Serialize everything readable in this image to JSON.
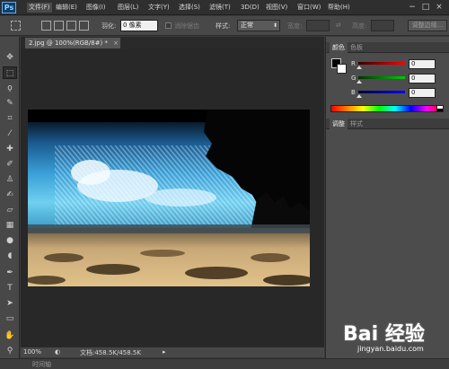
{
  "app": {
    "logo": "Ps"
  },
  "menu": [
    "文件(F)",
    "编辑(E)",
    "图像(I)",
    "图层(L)",
    "文字(Y)",
    "选择(S)",
    "滤镜(T)",
    "3D(D)",
    "视图(V)",
    "窗口(W)",
    "帮助(H)"
  ],
  "window_controls": [
    "−",
    "□",
    "×"
  ],
  "options_bar": {
    "feather_label": "羽化:",
    "feather_value": "0 像素",
    "antialias_label": "消除锯齿",
    "style_label": "样式:",
    "style_value": "正常",
    "width_label": "宽度:",
    "height_label": "高度:",
    "refine_edge": "调整边缘..."
  },
  "tools": [
    {
      "name": "move-tool",
      "glyph": "✥"
    },
    {
      "name": "marquee-tool",
      "glyph": "⬚"
    },
    {
      "name": "lasso-tool",
      "glyph": "ϙ"
    },
    {
      "name": "quick-select-tool",
      "glyph": "✎"
    },
    {
      "name": "crop-tool",
      "glyph": "⌗"
    },
    {
      "name": "eyedropper-tool",
      "glyph": "⁄"
    },
    {
      "name": "healing-brush-tool",
      "glyph": "✚"
    },
    {
      "name": "brush-tool",
      "glyph": "✐"
    },
    {
      "name": "clone-stamp-tool",
      "glyph": "♙"
    },
    {
      "name": "history-brush-tool",
      "glyph": "✍"
    },
    {
      "name": "eraser-tool",
      "glyph": "▱"
    },
    {
      "name": "gradient-tool",
      "glyph": "▦"
    },
    {
      "name": "blur-tool",
      "glyph": "●"
    },
    {
      "name": "dodge-tool",
      "glyph": "◖"
    },
    {
      "name": "pen-tool",
      "glyph": "✒"
    },
    {
      "name": "type-tool",
      "glyph": "T"
    },
    {
      "name": "path-select-tool",
      "glyph": "➤"
    },
    {
      "name": "shape-tool",
      "glyph": "▭"
    },
    {
      "name": "hand-tool",
      "glyph": "✋"
    },
    {
      "name": "zoom-tool",
      "glyph": "⚲"
    }
  ],
  "document": {
    "tab_title": "2.jpg @ 100%(RGB/8#)",
    "tab_modified": "*",
    "tab_close": "×"
  },
  "status": {
    "zoom": "100%",
    "doc_info": "文档:458.5K/458.5K"
  },
  "bottom_tab": "时间轴",
  "color_panel": {
    "tabs": [
      "颜色",
      "色板"
    ],
    "channels": [
      {
        "label": "R",
        "value": "0",
        "color": "#ff0000"
      },
      {
        "label": "G",
        "value": "0",
        "color": "#00cc00"
      },
      {
        "label": "B",
        "value": "0",
        "color": "#0000ff"
      }
    ],
    "foreground": "#000000",
    "background": "#ffffff"
  },
  "adjust_panel": {
    "tabs": [
      "调整",
      "样式"
    ]
  },
  "watermark": {
    "logo_text": "Bai 经验",
    "sub": "jingyan.baidu.com"
  }
}
